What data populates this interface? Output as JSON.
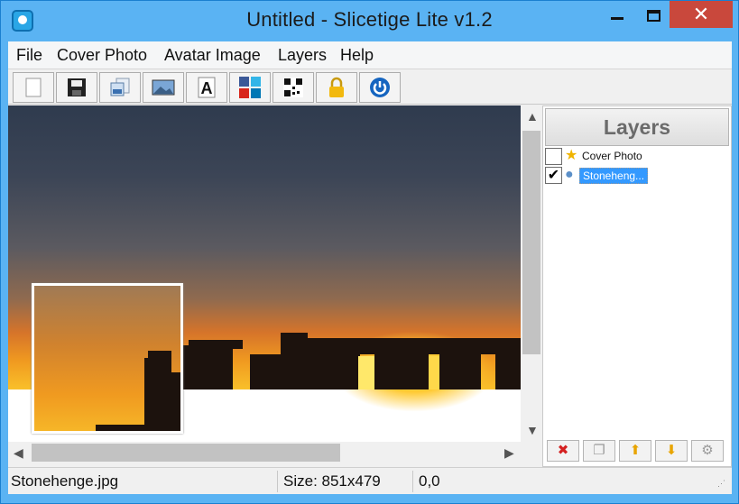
{
  "window": {
    "title": "Untitled  - Slicetige Lite v1.2",
    "minimize_glyph": "",
    "close_glyph": "✕"
  },
  "menu": [
    "File",
    "Cover Photo",
    "Avatar Image",
    "Layers",
    "Help"
  ],
  "toolbar": {
    "buttons": [
      {
        "icon": "new-document-icon"
      },
      {
        "icon": "save-icon"
      },
      {
        "icon": "export-images-icon"
      },
      {
        "icon": "cover-image-icon"
      },
      {
        "icon": "text-icon",
        "glyph": "A"
      },
      {
        "icon": "social-networks-icon"
      },
      {
        "icon": "qr-code-icon"
      },
      {
        "icon": "lock-icon"
      },
      {
        "icon": "power-icon"
      }
    ]
  },
  "layers": {
    "title": "Layers",
    "items": [
      {
        "label": "Cover Photo",
        "checked": false,
        "icon": "star-icon",
        "selected": false
      },
      {
        "label": "Stoneheng...",
        "checked": true,
        "icon": "image-layer-icon",
        "selected": true
      }
    ],
    "buttons": [
      {
        "icon": "delete-icon",
        "glyph": "✖",
        "color": "#d42020"
      },
      {
        "icon": "duplicate-icon",
        "glyph": "❐",
        "color": "#9a9a9a"
      },
      {
        "icon": "move-up-icon",
        "glyph": "⬆",
        "color": "#e8a400"
      },
      {
        "icon": "move-down-icon",
        "glyph": "⬇",
        "color": "#e8a400"
      },
      {
        "icon": "settings-icon",
        "glyph": "⚙",
        "color": "#9a9a9a"
      }
    ],
    "checkmark": "✔"
  },
  "status": {
    "file": "Stonehenge.jpg",
    "size": "Size: 851x479",
    "coords": "0,0"
  },
  "colors": {
    "title_bar": "#5ab3f3",
    "close_button": "#c9483c",
    "selection": "#3399ff"
  }
}
